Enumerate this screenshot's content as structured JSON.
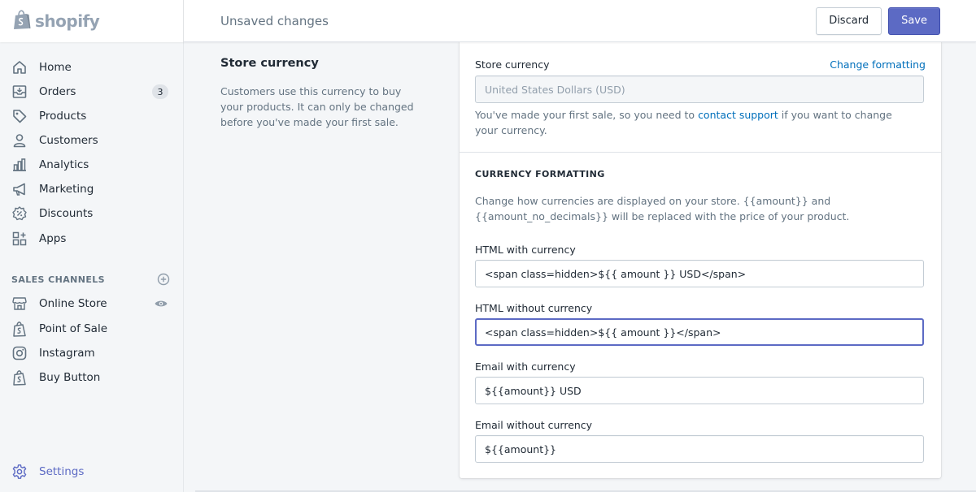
{
  "brand": {
    "name": "shopify"
  },
  "topbar": {
    "title": "Unsaved changes",
    "discard_label": "Discard",
    "save_label": "Save"
  },
  "sidebar": {
    "items": [
      {
        "label": "Home",
        "icon": "home-icon"
      },
      {
        "label": "Orders",
        "icon": "orders-icon",
        "badge": "3"
      },
      {
        "label": "Products",
        "icon": "tag-icon"
      },
      {
        "label": "Customers",
        "icon": "person-icon"
      },
      {
        "label": "Analytics",
        "icon": "bar-chart-icon"
      },
      {
        "label": "Marketing",
        "icon": "megaphone-icon"
      },
      {
        "label": "Discounts",
        "icon": "discount-icon"
      },
      {
        "label": "Apps",
        "icon": "apps-icon"
      }
    ],
    "sales_channels_title": "SALES CHANNELS",
    "channels": [
      {
        "label": "Online Store",
        "icon": "store-icon"
      },
      {
        "label": "Point of Sale",
        "icon": "shopify-bag-icon"
      },
      {
        "label": "Instagram",
        "icon": "instagram-icon"
      },
      {
        "label": "Buy Button",
        "icon": "shopify-bag-icon"
      }
    ],
    "settings_label": "Settings"
  },
  "annotation": {
    "title": "Store currency",
    "description": "Customers use this currency to buy your products. It can only be changed before you've made your first sale."
  },
  "card": {
    "store_currency_label": "Store currency",
    "change_formatting_link": "Change formatting",
    "currency_value": "United States Dollars (USD)",
    "help_before": "You've made your first sale, so you need to ",
    "help_link": "contact support",
    "help_after": " if you want to change your currency.",
    "formatting_heading": "CURRENCY FORMATTING",
    "formatting_desc": "Change how currencies are displayed on your store. {{amount}} and {{amount_no_decimals}} will be replaced with the price of your product.",
    "fields": [
      {
        "label": "HTML with currency",
        "value": "<span class=hidden>${{ amount }} USD</span>"
      },
      {
        "label": "HTML without currency",
        "value": "<span class=hidden>${{ amount }}</span>"
      },
      {
        "label": "Email with currency",
        "value": "${{amount}} USD"
      },
      {
        "label": "Email without currency",
        "value": "${{amount}}"
      }
    ]
  },
  "colors": {
    "accent": "#5c6ac4",
    "link": "#006fbb",
    "icon": "#637381"
  }
}
